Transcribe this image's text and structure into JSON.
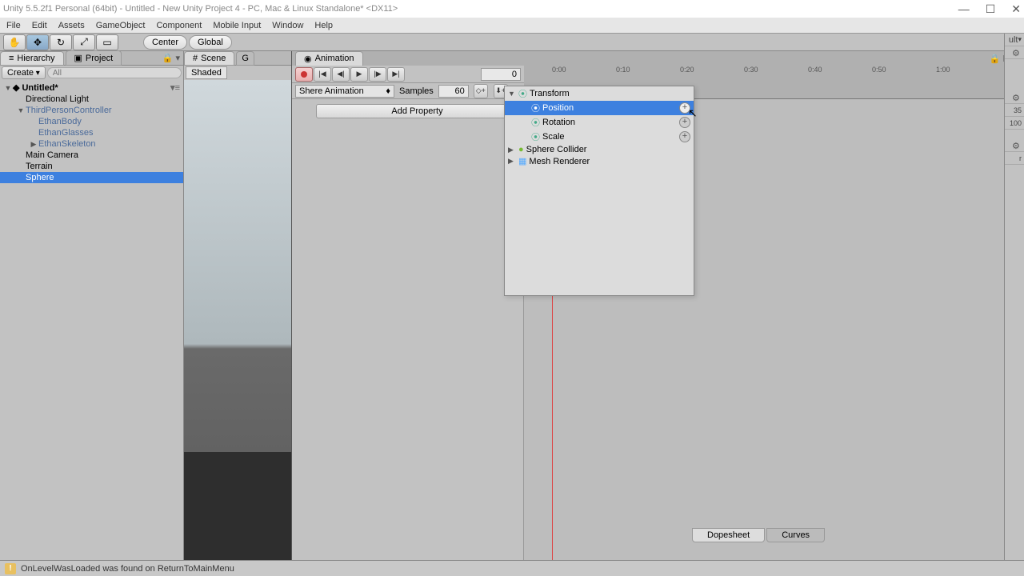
{
  "window": {
    "title": "Unity 5.5.2f1 Personal (64bit) - Untitled - New Unity Project 4 - PC, Mac & Linux Standalone* <DX11>"
  },
  "menu": {
    "items": [
      "File",
      "Edit",
      "Assets",
      "GameObject",
      "Component",
      "Mobile Input",
      "Window",
      "Help"
    ]
  },
  "toolbar": {
    "pivot": "Center",
    "space": "Global"
  },
  "hierarchy": {
    "tab_label": "Hierarchy",
    "project_tab": "Project",
    "create_label": "Create",
    "search_placeholder": "All",
    "scene_name": "Untitled*",
    "items": [
      {
        "label": "Directional Light",
        "indent": 1,
        "expand": ""
      },
      {
        "label": "ThirdPersonController",
        "indent": 1,
        "expand": "▼"
      },
      {
        "label": "EthanBody",
        "indent": 2,
        "expand": ""
      },
      {
        "label": "EthanGlasses",
        "indent": 2,
        "expand": ""
      },
      {
        "label": "EthanSkeleton",
        "indent": 2,
        "expand": "▶"
      },
      {
        "label": "Main Camera",
        "indent": 1,
        "expand": ""
      },
      {
        "label": "Terrain",
        "indent": 1,
        "expand": ""
      },
      {
        "label": "Sphere",
        "indent": 1,
        "expand": "",
        "selected": true
      }
    ]
  },
  "scene": {
    "tab_label": "Scene",
    "shading": "Shaded",
    "game_tab": "G"
  },
  "animation": {
    "tab_label": "Animation",
    "frame": "0",
    "clip": "Shere Animation",
    "samples_label": "Samples",
    "samples_value": "60",
    "add_property": "Add Property",
    "ruler_ticks": [
      "0:00",
      "0:10",
      "0:20",
      "0:30",
      "0:40",
      "0:50",
      "1:00"
    ],
    "bottom_tabs": {
      "dopesheet": "Dopesheet",
      "curves": "Curves"
    }
  },
  "property_popup": {
    "items": [
      {
        "label": "Transform",
        "expand": "▼",
        "indent": 0,
        "icon": "transform-icon",
        "plus": false
      },
      {
        "label": "Position",
        "expand": "",
        "indent": 1,
        "icon": "transform-icon",
        "plus": true,
        "selected": true
      },
      {
        "label": "Rotation",
        "expand": "",
        "indent": 1,
        "icon": "transform-icon",
        "plus": true
      },
      {
        "label": "Scale",
        "expand": "",
        "indent": 1,
        "icon": "transform-icon",
        "plus": true
      },
      {
        "label": "Sphere Collider",
        "expand": "▶",
        "indent": 0,
        "icon": "collider-icon",
        "plus": false
      },
      {
        "label": "Mesh Renderer",
        "expand": "▶",
        "indent": 0,
        "icon": "mesh-icon",
        "plus": false
      }
    ]
  },
  "inspector_strip": {
    "values": [
      "ult",
      "35",
      "100",
      "r"
    ]
  },
  "status": {
    "message": "OnLevelWasLoaded was found on ReturnToMainMenu"
  }
}
